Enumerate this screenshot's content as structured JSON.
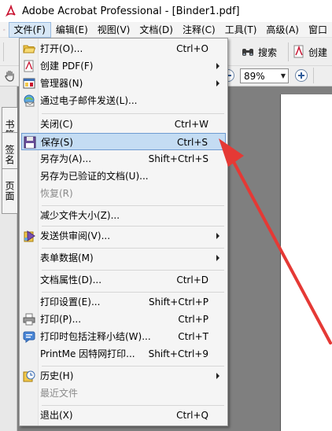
{
  "window": {
    "title": "Adobe Acrobat Professional - [Binder1.pdf]"
  },
  "menubar": {
    "items": [
      {
        "label": "文件(F)"
      },
      {
        "label": "编辑(E)"
      },
      {
        "label": "视图(V)"
      },
      {
        "label": "文档(D)"
      },
      {
        "label": "注释(C)"
      },
      {
        "label": "工具(T)"
      },
      {
        "label": "高级(A)"
      },
      {
        "label": "窗口"
      }
    ]
  },
  "toolbar": {
    "search_label": "搜索",
    "create_label": "创建",
    "zoom_value": "89%"
  },
  "side_panel": {
    "tabs": [
      "书签",
      "签名",
      "页面"
    ]
  },
  "file_menu": {
    "items": [
      {
        "label": "打开(O)...",
        "shortcut": "Ctrl+O",
        "icon": "open-folder-icon"
      },
      {
        "label": "创建 PDF(F)",
        "shortcut": "",
        "icon": "create-pdf-icon",
        "submenu": true
      },
      {
        "label": "管理器(N)",
        "shortcut": "",
        "icon": "organizer-icon",
        "submenu": true
      },
      {
        "label": "通过电子邮件发送(L)...",
        "shortcut": "",
        "icon": "email-icon"
      },
      {
        "label": "关闭(C)",
        "shortcut": "Ctrl+W"
      },
      {
        "label": "保存(S)",
        "shortcut": "Ctrl+S",
        "icon": "save-icon",
        "highlighted": true
      },
      {
        "label": "另存为(A)...",
        "shortcut": "Shift+Ctrl+S"
      },
      {
        "label": "另存为已验证的文档(U)..."
      },
      {
        "label": "恢复(R)",
        "disabled": true
      },
      {
        "label": "减少文件大小(Z)..."
      },
      {
        "label": "发送供审阅(V)...",
        "icon": "send-review-icon",
        "submenu": true
      },
      {
        "label": "表单数据(M)",
        "submenu": true
      },
      {
        "label": "文档属性(D)...",
        "shortcut": "Ctrl+D"
      },
      {
        "label": "打印设置(E)...",
        "shortcut": "Shift+Ctrl+P"
      },
      {
        "label": "打印(P)...",
        "shortcut": "Ctrl+P",
        "icon": "printer-icon"
      },
      {
        "label": "打印时包括注释小结(W)...",
        "shortcut": "Ctrl+T",
        "icon": "comment-summary-icon"
      },
      {
        "label": "PrintMe 因特网打印...",
        "shortcut": "Shift+Ctrl+9"
      },
      {
        "label": "历史(H)",
        "icon": "history-icon",
        "submenu": true
      },
      {
        "label": "最近文件",
        "disabled": true
      },
      {
        "label": "退出(X)",
        "shortcut": "Ctrl+Q"
      }
    ]
  },
  "colors": {
    "highlight_bg": "#c4dcf3",
    "highlight_border": "#6f9bd1",
    "annotation_arrow": "#e53935",
    "workspace_bg": "#7f7f7f"
  }
}
